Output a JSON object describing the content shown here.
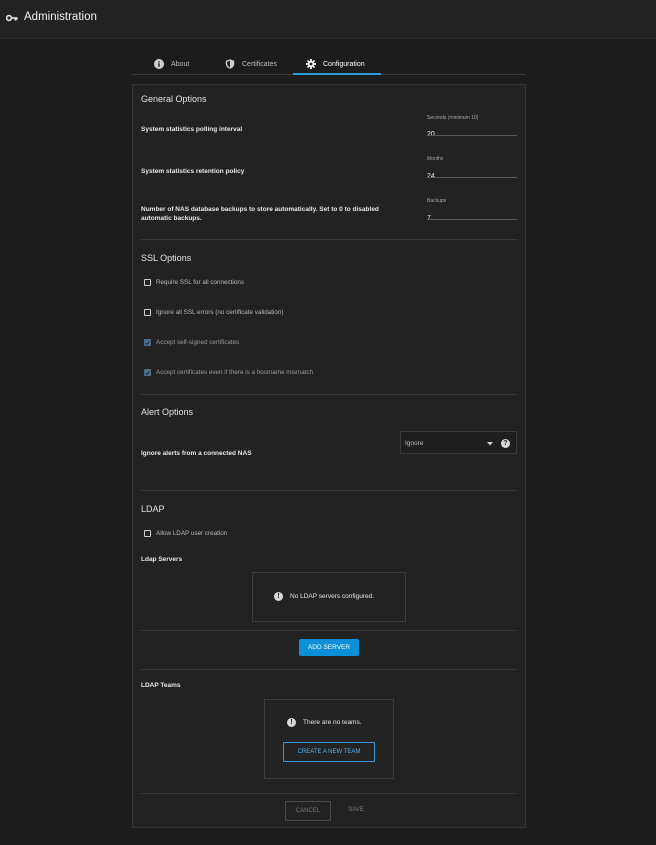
{
  "header": {
    "title": "Administration",
    "icon": "key-icon"
  },
  "tabs": [
    {
      "label": "About",
      "icon": "info-icon",
      "active": false
    },
    {
      "label": "Certificates",
      "icon": "shield-icon",
      "active": false
    },
    {
      "label": "Configuration",
      "icon": "gear-icon",
      "active": true
    }
  ],
  "general": {
    "heading": "General Options",
    "polling": {
      "label": "System statistics polling interval",
      "hint": "Seconds (minimum 10)",
      "value": "20"
    },
    "retention": {
      "label": "System statistics retention policy",
      "hint": "Months",
      "value": "24"
    },
    "backups": {
      "label_line1": "Number of NAS database backups to store automatically. Set to 0 to disabled",
      "label_line2": "automatic backups.",
      "hint": "Backups",
      "value": "7"
    }
  },
  "ssl": {
    "heading": "SSL Options",
    "options": [
      {
        "label": "Require SSL for all connections",
        "checked": false
      },
      {
        "label": "Ignore all SSL errors (no certificate validation)",
        "checked": false
      },
      {
        "label": "Accept self-signed certificates",
        "checked": true
      },
      {
        "label": "Accept certificates even if there is a hostname mismatch",
        "checked": true
      }
    ]
  },
  "alerts": {
    "heading": "Alert Options",
    "label": "Ignore alerts from a connected NAS",
    "selected": "Ignore"
  },
  "ldap": {
    "heading": "LDAP",
    "allow_creation": {
      "label": "Allow LDAP user creation",
      "checked": false
    },
    "servers_label": "Ldap Servers",
    "no_servers": "No LDAP servers configured.",
    "add_server": "ADD SERVER",
    "teams_label": "LDAP Teams",
    "no_teams": "There are no teams.",
    "create_team": "CREATE A NEW TEAM"
  },
  "footer": {
    "cancel": "CANCEL",
    "save": "SAVE"
  },
  "colors": {
    "accent": "#2f9dd8",
    "primary_button": "#0b8fd8",
    "background": "#1c1c1c",
    "panel": "#222222"
  }
}
